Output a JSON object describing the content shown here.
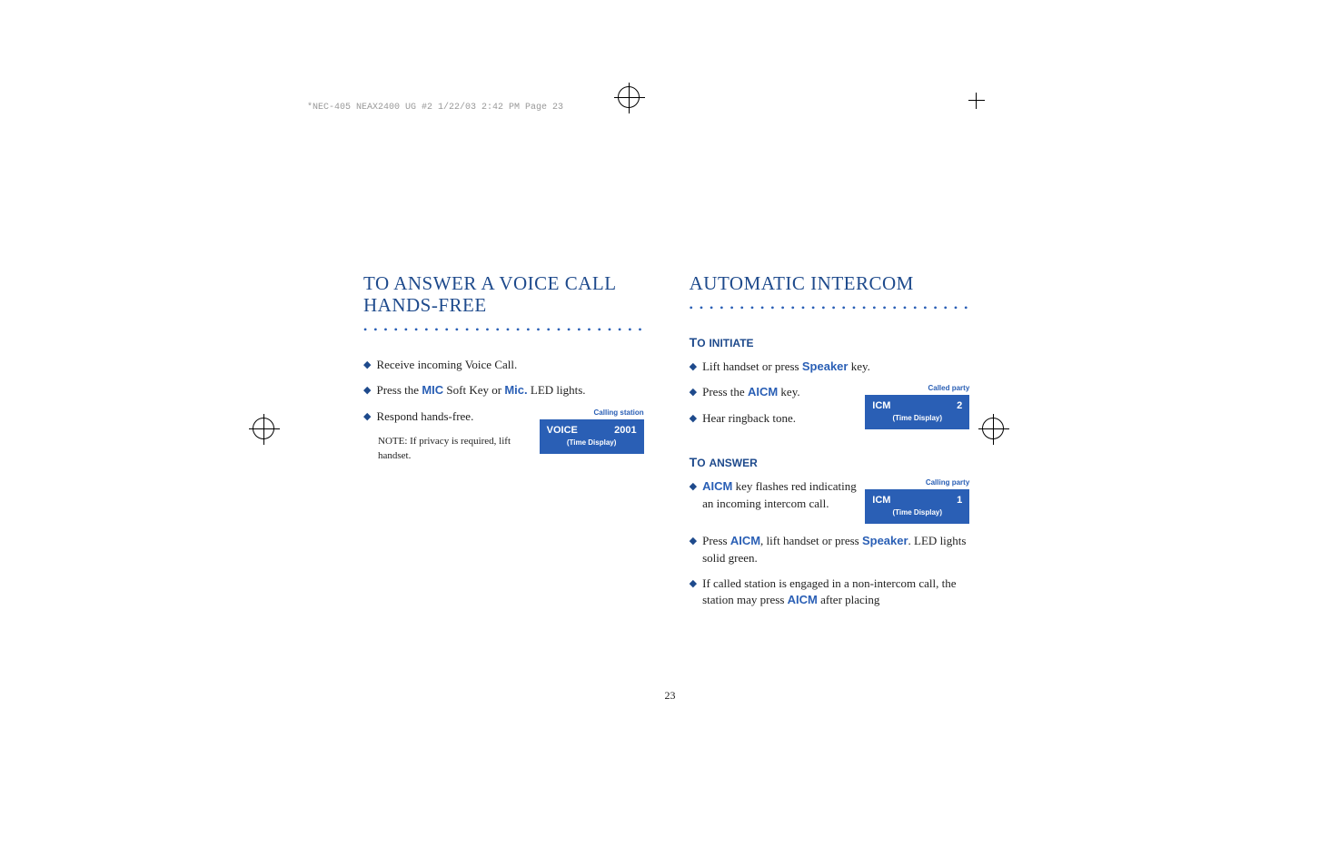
{
  "header": "*NEC-405 NEAX2400 UG #2  1/22/03  2:42 PM  Page 23",
  "pageNumber": "23",
  "left": {
    "title": "TO ANSWER A VOICE CALL HANDS-FREE",
    "bullets": [
      "Receive incoming Voice Call.",
      "Press the |MIC| Soft Key or |Mic.| LED lights.",
      "Respond hands-free."
    ],
    "note": "NOTE: If privacy is required, lift handset.",
    "display": {
      "label": "Calling station",
      "line1_left": "VOICE",
      "line1_right": "2001",
      "line2": "(Time Display)"
    }
  },
  "right": {
    "title": "AUTOMATIC INTERCOM",
    "initiate": {
      "heading": "TO INITIATE",
      "bullets": [
        "Lift handset or press |Speaker| key.",
        "Press the |AICM| key.",
        "Hear ringback tone."
      ],
      "display": {
        "label": "Called party",
        "line1_left": "ICM",
        "line1_right": "2",
        "line2": "(Time Display)"
      }
    },
    "answer": {
      "heading": "TO ANSWER",
      "bullet1": "|AICM| key flashes red indicating an incoming intercom call.",
      "bullet2": "Press |AICM|, lift handset or press |Speaker|. LED lights solid green.",
      "bullet3": "If called station is engaged in a non-intercom call, the station may press |AICM| after placing",
      "display": {
        "label": "Calling party",
        "line1_left": "ICM",
        "line1_right": "1",
        "line2": "(Time Display)"
      }
    }
  }
}
